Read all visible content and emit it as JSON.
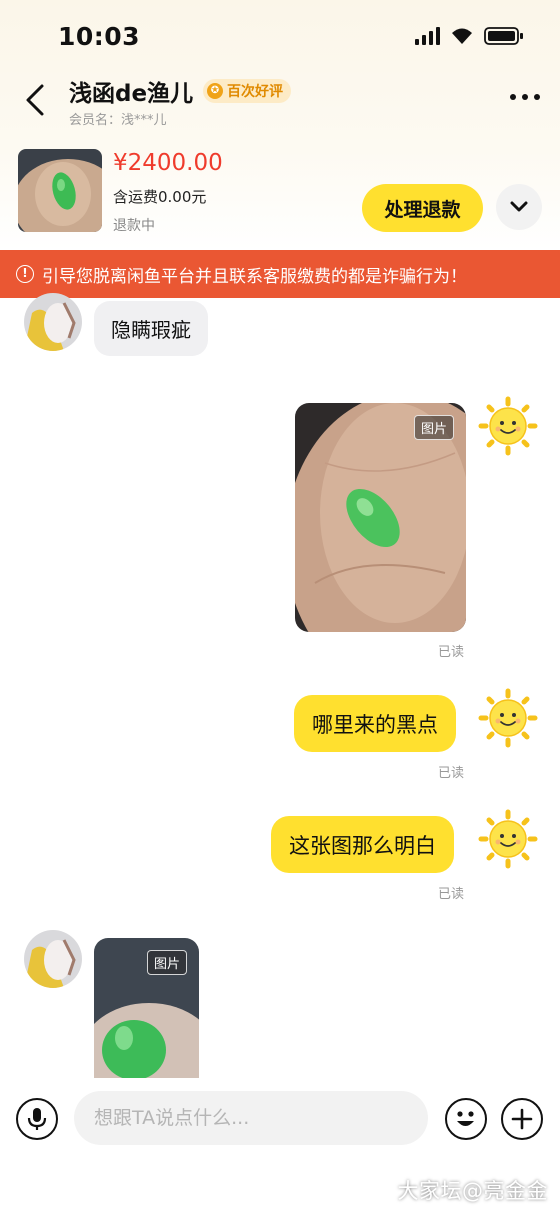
{
  "status_bar": {
    "time": "10:03"
  },
  "header": {
    "seller_name": "浅函de渔儿",
    "badge_label": "百次好评",
    "member_label": "会员名：浅***儿"
  },
  "product": {
    "price": "¥2400.00",
    "shipping": "含运费0.00元",
    "status": "退款中",
    "action_label": "处理退款"
  },
  "warning": {
    "text": "引导您脱离闲鱼平台并且联系客服缴费的都是诈骗行为！"
  },
  "messages": [
    {
      "side": "left",
      "type": "text",
      "text": "隐瞒瑕疵"
    },
    {
      "side": "right",
      "type": "image",
      "tag": "图片",
      "read": "已读"
    },
    {
      "side": "right",
      "type": "text",
      "text": "哪里来的黑点",
      "read": "已读"
    },
    {
      "side": "right",
      "type": "text",
      "text": "这张图那么明白",
      "read": "已读"
    },
    {
      "side": "left",
      "type": "image",
      "tag": "图片"
    }
  ],
  "input": {
    "placeholder": "想跟TA说点什么..."
  },
  "watermark": "大家坛@亮金金",
  "colors": {
    "accent": "#ffe02f",
    "price": "#ef3b2c",
    "warning_bg": "#ea5733",
    "badge": "#f0a318"
  }
}
